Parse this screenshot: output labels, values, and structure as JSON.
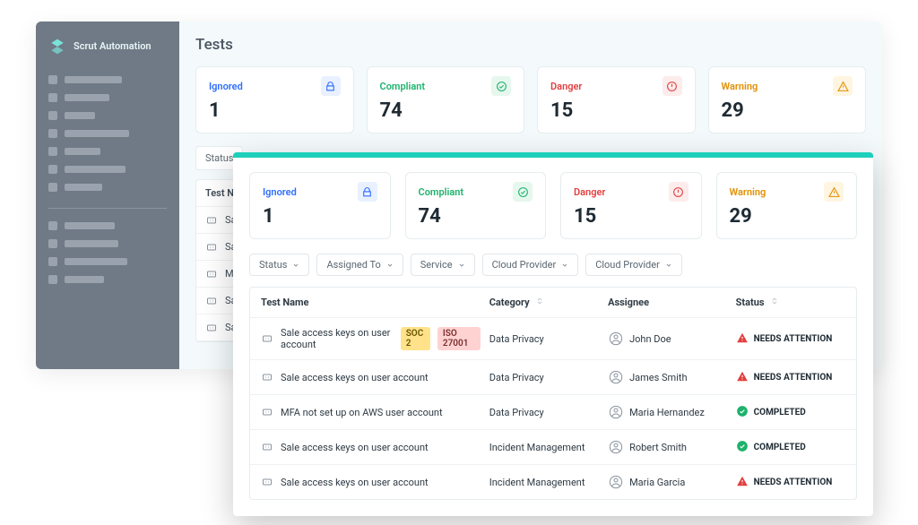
{
  "brand": {
    "name": "Scrut Automation"
  },
  "page": {
    "title": "Tests"
  },
  "stats": {
    "ignored": {
      "label": "Ignored",
      "value": "1"
    },
    "compliant": {
      "label": "Compliant",
      "value": "74"
    },
    "danger": {
      "label": "Danger",
      "value": "15"
    },
    "warning": {
      "label": "Warning",
      "value": "29"
    }
  },
  "filters": {
    "status": "Status",
    "assigned": "Assigned To",
    "service": "Service",
    "cloud1": "Cloud Provider",
    "cloud2": "Cloud Provider"
  },
  "back_toolbar": {
    "status": "Status",
    "test_name": "Test Nar"
  },
  "back_rows": {
    "r0": "Sale",
    "r1": "Sale",
    "r2": "MFA",
    "r3": "Sale",
    "r4": "Sale"
  },
  "table": {
    "head": {
      "name": "Test Name",
      "category": "Category",
      "assignee": "Assignee",
      "status": "Status"
    },
    "rows": [
      {
        "name": "Sale access keys on user account",
        "tags": [
          "SOC 2",
          "ISO 27001"
        ],
        "category": "Data Privacy",
        "assignee": "John Doe",
        "status": "NEEDS ATTENTION",
        "status_kind": "attention"
      },
      {
        "name": "Sale access keys on user account",
        "tags": [],
        "category": "Data Privacy",
        "assignee": "James Smith",
        "status": "NEEDS ATTENTION",
        "status_kind": "attention"
      },
      {
        "name": "MFA not set up on AWS user account",
        "tags": [],
        "category": "Data Privacy",
        "assignee": "Maria Hernandez",
        "status": "COMPLETED",
        "status_kind": "completed"
      },
      {
        "name": "Sale access keys on user account",
        "tags": [],
        "category": "Incident Management",
        "assignee": "Robert Smith",
        "status": "COMPLETED",
        "status_kind": "completed"
      },
      {
        "name": "Sale access keys on user account",
        "tags": [],
        "category": "Incident Management",
        "assignee": "Maria Garcia",
        "status": "NEEDS ATTENTION",
        "status_kind": "attention"
      }
    ]
  },
  "icons": {
    "lock": "lock-icon",
    "check": "check-circle-icon",
    "alert": "alert-circle-icon",
    "warn": "warning-triangle-icon",
    "chev": "chevron-down-icon",
    "sort": "sort-icon",
    "key": "key-icon",
    "user": "user-avatar-icon",
    "status_attention": "warning-triangle-icon",
    "status_completed": "check-circle-icon"
  }
}
